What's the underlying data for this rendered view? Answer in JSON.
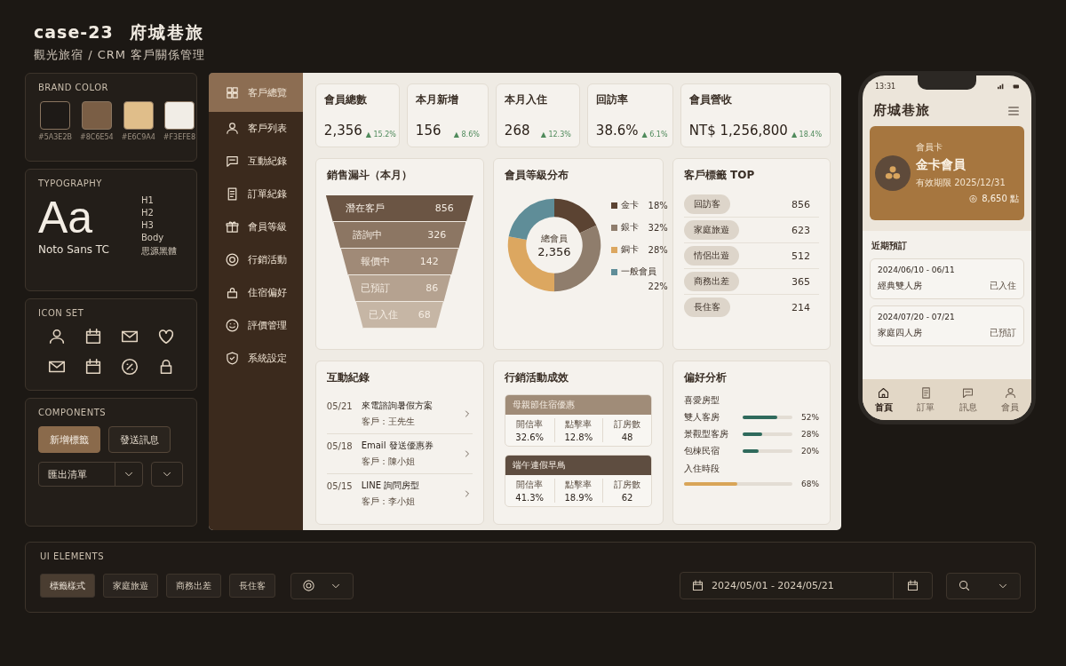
{
  "header": {
    "title": "case-23",
    "name": "府城巷旅",
    "subtitle": "觀光旅宿 / CRM 客戶關係管理"
  },
  "brand": {
    "title": "BRAND COLOR",
    "swatches": [
      {
        "label": "#5A3E2B",
        "color": "#1e1a17"
      },
      {
        "label": "#8C6E54",
        "color": "#7a5e45"
      },
      {
        "label": "#E6C9A4",
        "color": "#e0be8a"
      },
      {
        "label": "#F3EFE8",
        "color": "#f1ede6"
      }
    ]
  },
  "typography": {
    "title": "TYPOGRAPHY",
    "sample": "Aa",
    "font": "Noto Sans TC",
    "styles": [
      "H1",
      "H2",
      "H3",
      "Body",
      "思源黑體"
    ]
  },
  "icon_set": {
    "title": "ICON SET"
  },
  "components": {
    "title": "COMPONENTS",
    "buttons": [
      {
        "label": "新增標籤",
        "kind": "primary"
      },
      {
        "label": "發送訊息",
        "kind": "secondary"
      }
    ],
    "select": "匯出清單"
  },
  "nav": [
    {
      "label": "客戶總覽",
      "selected": true
    },
    {
      "label": "客戶列表",
      "selected": false
    },
    {
      "label": "互動紀錄",
      "selected": false
    },
    {
      "label": "訂單紀錄",
      "selected": false
    },
    {
      "label": "會員等級",
      "selected": false
    },
    {
      "label": "行銷活動",
      "selected": false
    },
    {
      "label": "住宿偏好",
      "selected": false
    },
    {
      "label": "評價管理",
      "selected": false
    },
    {
      "label": "系統設定",
      "selected": false
    }
  ],
  "kpis": [
    {
      "label": "會員總數",
      "value": "2,356",
      "delta": "▲ 15.2%"
    },
    {
      "label": "本月新增",
      "value": "156",
      "delta": "▲ 8.6%"
    },
    {
      "label": "本月入住",
      "value": "268",
      "delta": "▲ 12.3%"
    },
    {
      "label": "回訪率",
      "value": "38.6%",
      "delta": "▲ 6.1%"
    },
    {
      "label": "會員營收",
      "value": "NT$ 1,256,800",
      "delta": "▲ 18.4%"
    }
  ],
  "funnel": {
    "title": "銷售漏斗（本月）",
    "stages": [
      {
        "label": "潛在客戶",
        "value": "856"
      },
      {
        "label": "諮詢中",
        "value": "326"
      },
      {
        "label": "報價中",
        "value": "142"
      },
      {
        "label": "已預訂",
        "value": "86"
      },
      {
        "label": "已入住",
        "value": "68"
      }
    ]
  },
  "tiers": {
    "title": "會員等級分布",
    "center_label": "總會員",
    "center_value": "2,356",
    "legend": [
      {
        "pct": "18%",
        "color": "#5b4332"
      },
      {
        "pct": "32%",
        "color": "#8f7d6c"
      },
      {
        "pct": "28%",
        "color": "#dca760"
      },
      {
        "pct": "22%",
        "color": "#5f8d98"
      }
    ],
    "chart_data": {
      "type": "donut",
      "categories": [
        "金卡",
        "銀卡",
        "銅卡",
        "一般會員"
      ],
      "values": [
        18,
        32,
        28,
        22
      ]
    }
  },
  "tags": {
    "title": "客戶標籤 TOP",
    "items": [
      {
        "label": "回訪客",
        "count": "856"
      },
      {
        "label": "家庭旅遊",
        "count": "623"
      },
      {
        "label": "情侶出遊",
        "count": "512"
      },
      {
        "label": "商務出差",
        "count": "365"
      },
      {
        "label": "長住客",
        "count": "214"
      }
    ]
  },
  "interactions": {
    "title": "互動紀錄",
    "items": [
      {
        "date": "05/21",
        "subject": "來電諮詢暑假方案",
        "customer": "客戶：王先生"
      },
      {
        "date": "05/18",
        "subject": "Email 發送優惠券",
        "customer": "客戶：陳小姐"
      },
      {
        "date": "05/15",
        "subject": "LINE 詢問房型",
        "customer": "客戶：李小姐"
      }
    ]
  },
  "campaigns": {
    "title": "行銷活動成效",
    "items": [
      {
        "name": "母親節住宿優惠",
        "color": "#a08c78",
        "metrics": [
          {
            "label": "開信率",
            "value": "32.6%"
          },
          {
            "label": "點擊率",
            "value": "12.8%"
          },
          {
            "label": "訂房數",
            "value": "48"
          }
        ]
      },
      {
        "name": "端午連假早鳥",
        "color": "#5e4d40",
        "metrics": [
          {
            "label": "開信率",
            "value": "41.3%"
          },
          {
            "label": "點擊率",
            "value": "18.9%"
          },
          {
            "label": "訂房數",
            "value": "62"
          }
        ]
      }
    ]
  },
  "preferences": {
    "title": "偏好分析",
    "groups": [
      {
        "title": "喜愛房型",
        "color": "#2f6a5c",
        "items": [
          {
            "label": "雙人客房",
            "level": 0.7,
            "reading": "52%"
          },
          {
            "label": "景觀型客房",
            "level": 0.4,
            "reading": "28%"
          },
          {
            "label": "包棟民宿",
            "level": 0.33,
            "reading": "20%"
          }
        ]
      },
      {
        "title": "入住時段",
        "color": "#d9a558",
        "items": [
          {
            "level": 0.49,
            "reading": "68%"
          }
        ]
      }
    ]
  },
  "phone": {
    "time": "13:31",
    "title": "府城巷旅",
    "card": {
      "caption": "會員卡",
      "tier": "金卡會員",
      "expiry": "有效期限 2025/12/31",
      "points": "8,650 點"
    },
    "section": "近期預訂",
    "bookings": [
      {
        "dates": "2024/06/10 - 06/11",
        "room": "經典雙人房",
        "status": "已入住"
      },
      {
        "dates": "2024/07/20 - 07/21",
        "room": "家庭四人房",
        "status": "已預訂"
      }
    ],
    "tabs": [
      {
        "label": "首頁",
        "selected": true
      },
      {
        "label": "訂單",
        "selected": false
      },
      {
        "label": "訊息",
        "selected": false
      },
      {
        "label": "會員",
        "selected": false
      }
    ]
  },
  "ui_elements": {
    "title": "UI ELEMENTS",
    "chips": [
      {
        "label": "標籤樣式",
        "selected": true
      },
      {
        "label": "家庭旅遊",
        "selected": false
      },
      {
        "label": "商務出差",
        "selected": false
      },
      {
        "label": "長住客",
        "selected": false
      }
    ],
    "date_range": "2024/05/01 - 2024/05/21"
  }
}
